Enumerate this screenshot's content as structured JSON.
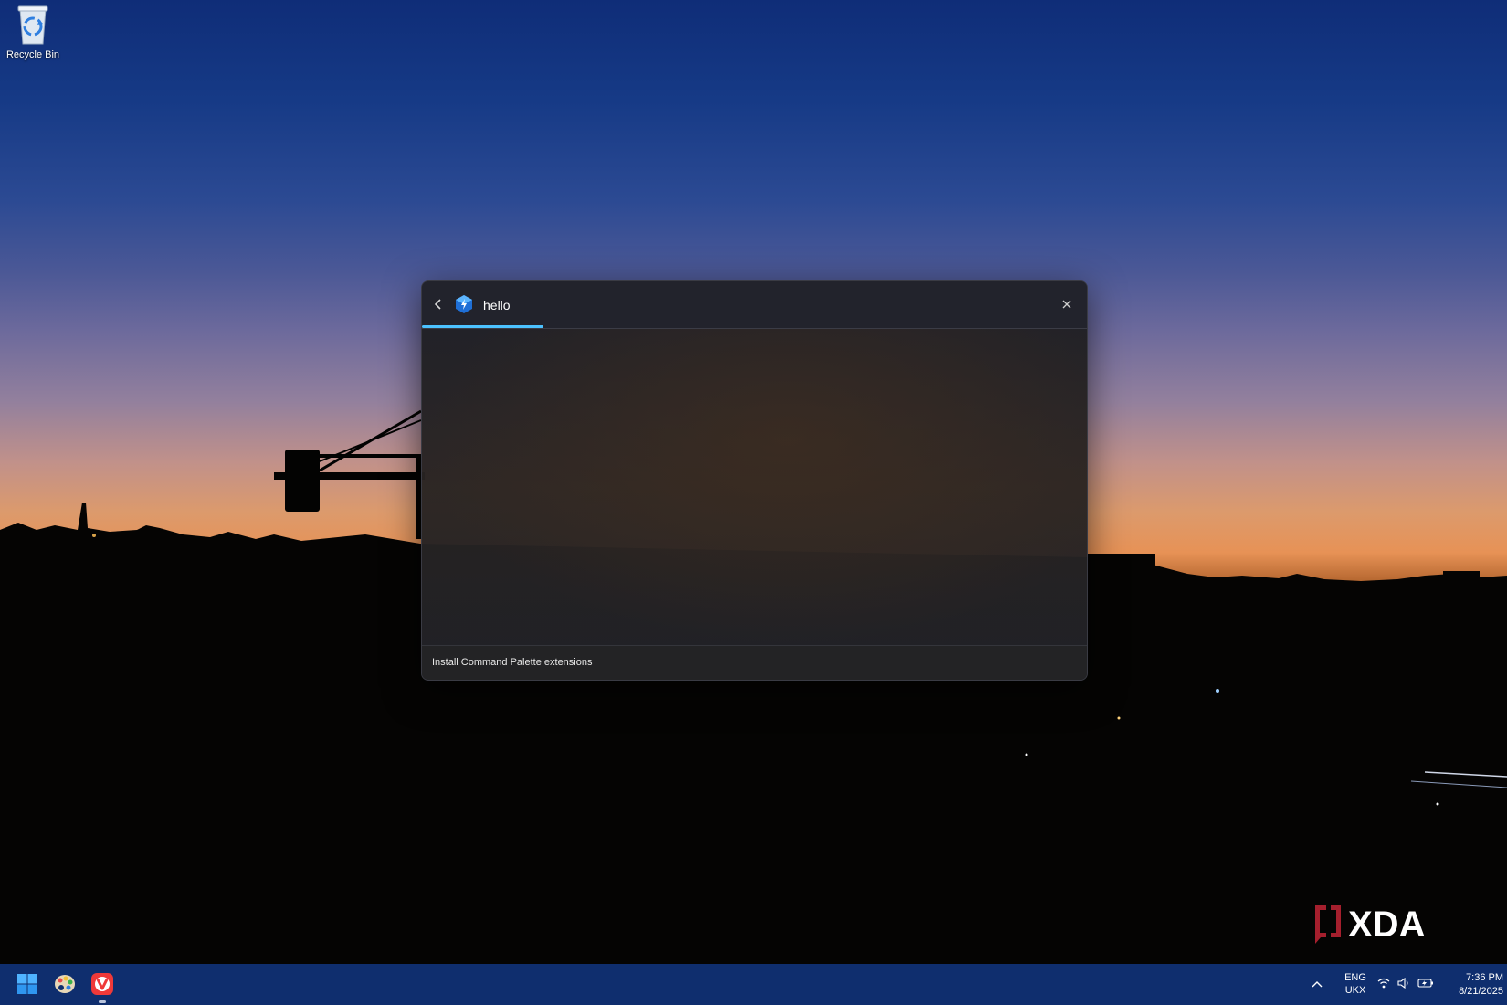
{
  "desktop": {
    "icons": [
      {
        "label": "Recycle Bin",
        "icon": "recycle-bin-icon"
      }
    ]
  },
  "palette": {
    "search": {
      "value": "hello",
      "placeholder": ""
    },
    "footer_link": "Install Command Palette extensions",
    "accent_color": "#4cc2ff",
    "back_icon": "chevron-left-icon",
    "close_icon": "close-icon",
    "app_icon": "command-palette-icon"
  },
  "watermark": {
    "text": "XDA"
  },
  "taskbar": {
    "apps": [
      {
        "name": "start-button",
        "icon": "windows-logo-icon"
      },
      {
        "name": "paint-app",
        "icon": "palette-icon"
      },
      {
        "name": "vivaldi-browser",
        "icon": "vivaldi-icon"
      }
    ],
    "language": {
      "line1": "ENG",
      "line2": "UKX"
    },
    "clock": {
      "time": "7:36 PM",
      "date": "8/21/2025"
    },
    "tray_icons": [
      "wifi-icon",
      "volume-icon",
      "battery-icon"
    ]
  }
}
